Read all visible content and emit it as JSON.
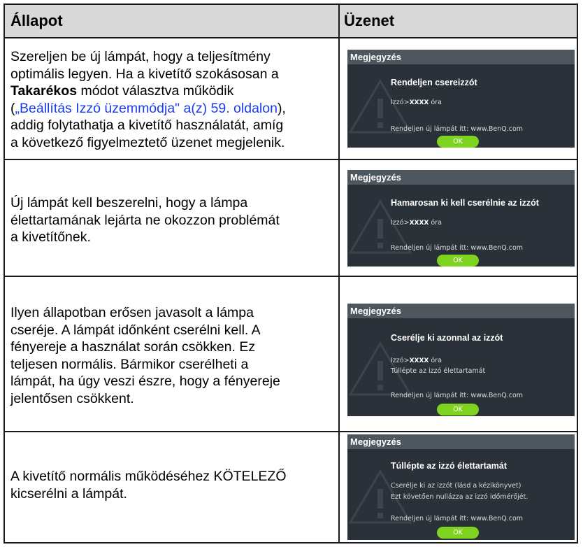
{
  "header": {
    "col1": "Állapot",
    "col2": "Üzenet"
  },
  "rows": [
    {
      "lines": [
        "Szereljen be új lámpát, hogy a teljesítmény",
        "optimális legyen. Ha a kivetítő szokásosan a"
      ],
      "bold_word": "Takarékos",
      "bold_tail": " módot választva működik",
      "link_open": "(",
      "link_text": "„Beállítás Izzó üzemmódja\" a(z) 59. oldalon",
      "link_close": "),",
      "lines_after": [
        "addig folytathatja a kivetítő használatát, amíg",
        "a következő figyelmeztető üzenet megjelenik."
      ],
      "dialog": {
        "title": "Megjegyzés",
        "heading": "Rendeljen csereizzót",
        "lamp_prefix": "Izzó>",
        "lamp_value": "XXXX",
        "lamp_suffix": " óra",
        "extra": [],
        "contact": "Rendeljen új lámpát itt: www.BenQ.com",
        "ok": "OK"
      }
    },
    {
      "lines": [
        "Új lámpát kell beszerelni, hogy a lámpa",
        "élettartamának lejárta ne okozzon problémát",
        "a kivetítőnek."
      ],
      "dialog": {
        "title": "Megjegyzés",
        "heading": "Hamarosan ki kell cserélnie az izzót",
        "lamp_prefix": "Izzó>",
        "lamp_value": "XXXX",
        "lamp_suffix": " óra",
        "extra": [],
        "contact": "Rendeljen új lámpát itt: www.BenQ.com",
        "ok": "OK"
      }
    },
    {
      "lines": [
        "Ilyen állapotban erősen javasolt a lámpa",
        "cseréje. A lámpát időnként cserélni kell. A",
        "fényereje a használat során csökken. Ez",
        "teljesen normális. Bármikor cserélheti a",
        "lámpát, ha úgy veszi észre, hogy a fényereje",
        "jelentősen csökkent."
      ],
      "dialog": {
        "title": "Megjegyzés",
        "heading": "Cserélje ki azonnal az izzót",
        "lamp_prefix": "Izzó>",
        "lamp_value": "XXXX",
        "lamp_suffix": " óra",
        "extra": [
          "Túllépte az izzó élettartamát"
        ],
        "contact": "Rendeljen új lámpát itt: www.BenQ.com",
        "ok": "OK"
      }
    },
    {
      "lines": [
        "A kivetítő normális működéséhez KÖTELEZŐ",
        "kicserélni a lámpát."
      ],
      "dialog": {
        "title": "Megjegyzés",
        "heading": "Túllépte az izzó élettartamát",
        "extra": [
          "Cserélje ki az izzót (lásd a kézikönyvet)",
          "Ezt követően nullázza az izzó időmérőjét."
        ],
        "contact": "Rendeljen új lámpát itt: www.BenQ.com",
        "ok": "OK"
      }
    }
  ]
}
